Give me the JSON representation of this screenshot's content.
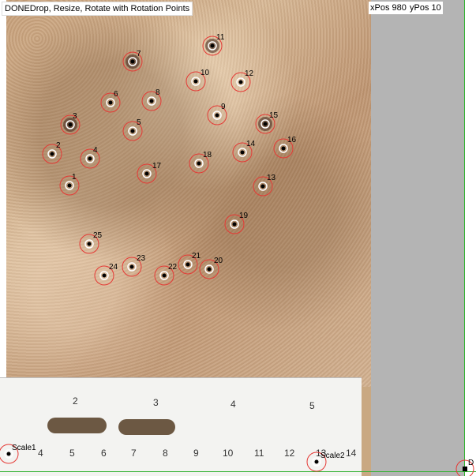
{
  "header": {
    "status": "DONE",
    "instruction": "Drop, Resize, Rotate with Rotation Points",
    "xpos_label": "xPos 980",
    "ypos_label": "yPos 10"
  },
  "landmarks": [
    {
      "id": "1",
      "label": "1"
    },
    {
      "id": "2",
      "label": "2"
    },
    {
      "id": "3",
      "label": "3"
    },
    {
      "id": "4",
      "label": "4"
    },
    {
      "id": "5",
      "label": "5"
    },
    {
      "id": "6",
      "label": "6"
    },
    {
      "id": "7",
      "label": "7"
    },
    {
      "id": "8",
      "label": "8"
    },
    {
      "id": "9",
      "label": "9"
    },
    {
      "id": "10",
      "label": "10"
    },
    {
      "id": "11",
      "label": "11"
    },
    {
      "id": "12",
      "label": "12"
    },
    {
      "id": "13",
      "label": "13"
    },
    {
      "id": "14",
      "label": "14"
    },
    {
      "id": "15",
      "label": "15"
    },
    {
      "id": "16",
      "label": "16"
    },
    {
      "id": "17",
      "label": "17"
    },
    {
      "id": "18",
      "label": "18"
    },
    {
      "id": "19",
      "label": "19"
    },
    {
      "id": "20",
      "label": "20"
    },
    {
      "id": "21",
      "label": "21"
    },
    {
      "id": "22",
      "label": "22"
    },
    {
      "id": "23",
      "label": "23"
    },
    {
      "id": "24",
      "label": "24"
    },
    {
      "id": "25",
      "label": "25"
    }
  ],
  "scale_points": {
    "scale1": "Scale1",
    "scale2": "Scale2",
    "done_marker": "D"
  },
  "ruler": {
    "inch_labels": [
      "2",
      "3",
      "4",
      "5"
    ],
    "cm_labels": [
      "4",
      "5",
      "6",
      "7",
      "8",
      "9",
      "10",
      "11",
      "12",
      "13",
      "14"
    ]
  },
  "colors": {
    "marker_ring": "#e53935",
    "guide_line": "#34b234",
    "panel_gray": "#b4b4b4"
  }
}
